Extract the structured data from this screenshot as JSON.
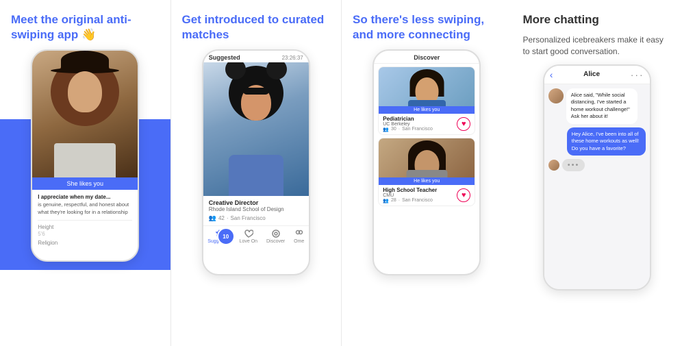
{
  "panels": [
    {
      "id": "panel1",
      "title": "Meet the original anti-swiping app 👋",
      "subtitle": "",
      "phone": {
        "she_likes_you": "She likes you",
        "quote_title": "I appreciate when my date...",
        "quote_text": "is genuine, respectful, and honest about what they're looking for in a relationship",
        "attr1_label": "Height",
        "attr1_value": "5'6",
        "attr2_label": "Religion",
        "attr2_value": ""
      }
    },
    {
      "id": "panel2",
      "title": "Get introduced to curated matches",
      "subtitle": "",
      "phone": {
        "suggested_label": "Suggested",
        "timer": "23:26:37",
        "person_title": "Creative Director",
        "person_school": "Rhode Island School of Design",
        "person_age": "42",
        "person_location": "San Francisco",
        "badge_count": "10",
        "nav_items": [
          "Suggested",
          "Love On",
          "Discover",
          "Ome"
        ]
      }
    },
    {
      "id": "panel3",
      "title": "So there's less swiping, and more connecting",
      "subtitle": "",
      "phone": {
        "discover_label": "Discover",
        "match1": {
          "he_likes_you": "He likes you",
          "title": "Pediatrician",
          "school": "UC Berkeley",
          "age": "30",
          "location": "San Francisco"
        },
        "match2": {
          "he_likes_you": "He likes you",
          "title": "High School Teacher",
          "school": "CMU",
          "age": "28",
          "location": "San Francisco"
        }
      }
    },
    {
      "id": "panel4",
      "title": "More chatting",
      "subtitle": "Personalized icebreakers make it easy to start good conversation.",
      "phone": {
        "chat_name": "Alice",
        "message1": "Alice said, \"While social distancing, I've started a home workout challenge!\" Ask her about it!",
        "message2": "Hey Alice, I've been into all of these home workouts as well! Do you have a favorite?",
        "typing_indicator": "•••"
      }
    }
  ]
}
